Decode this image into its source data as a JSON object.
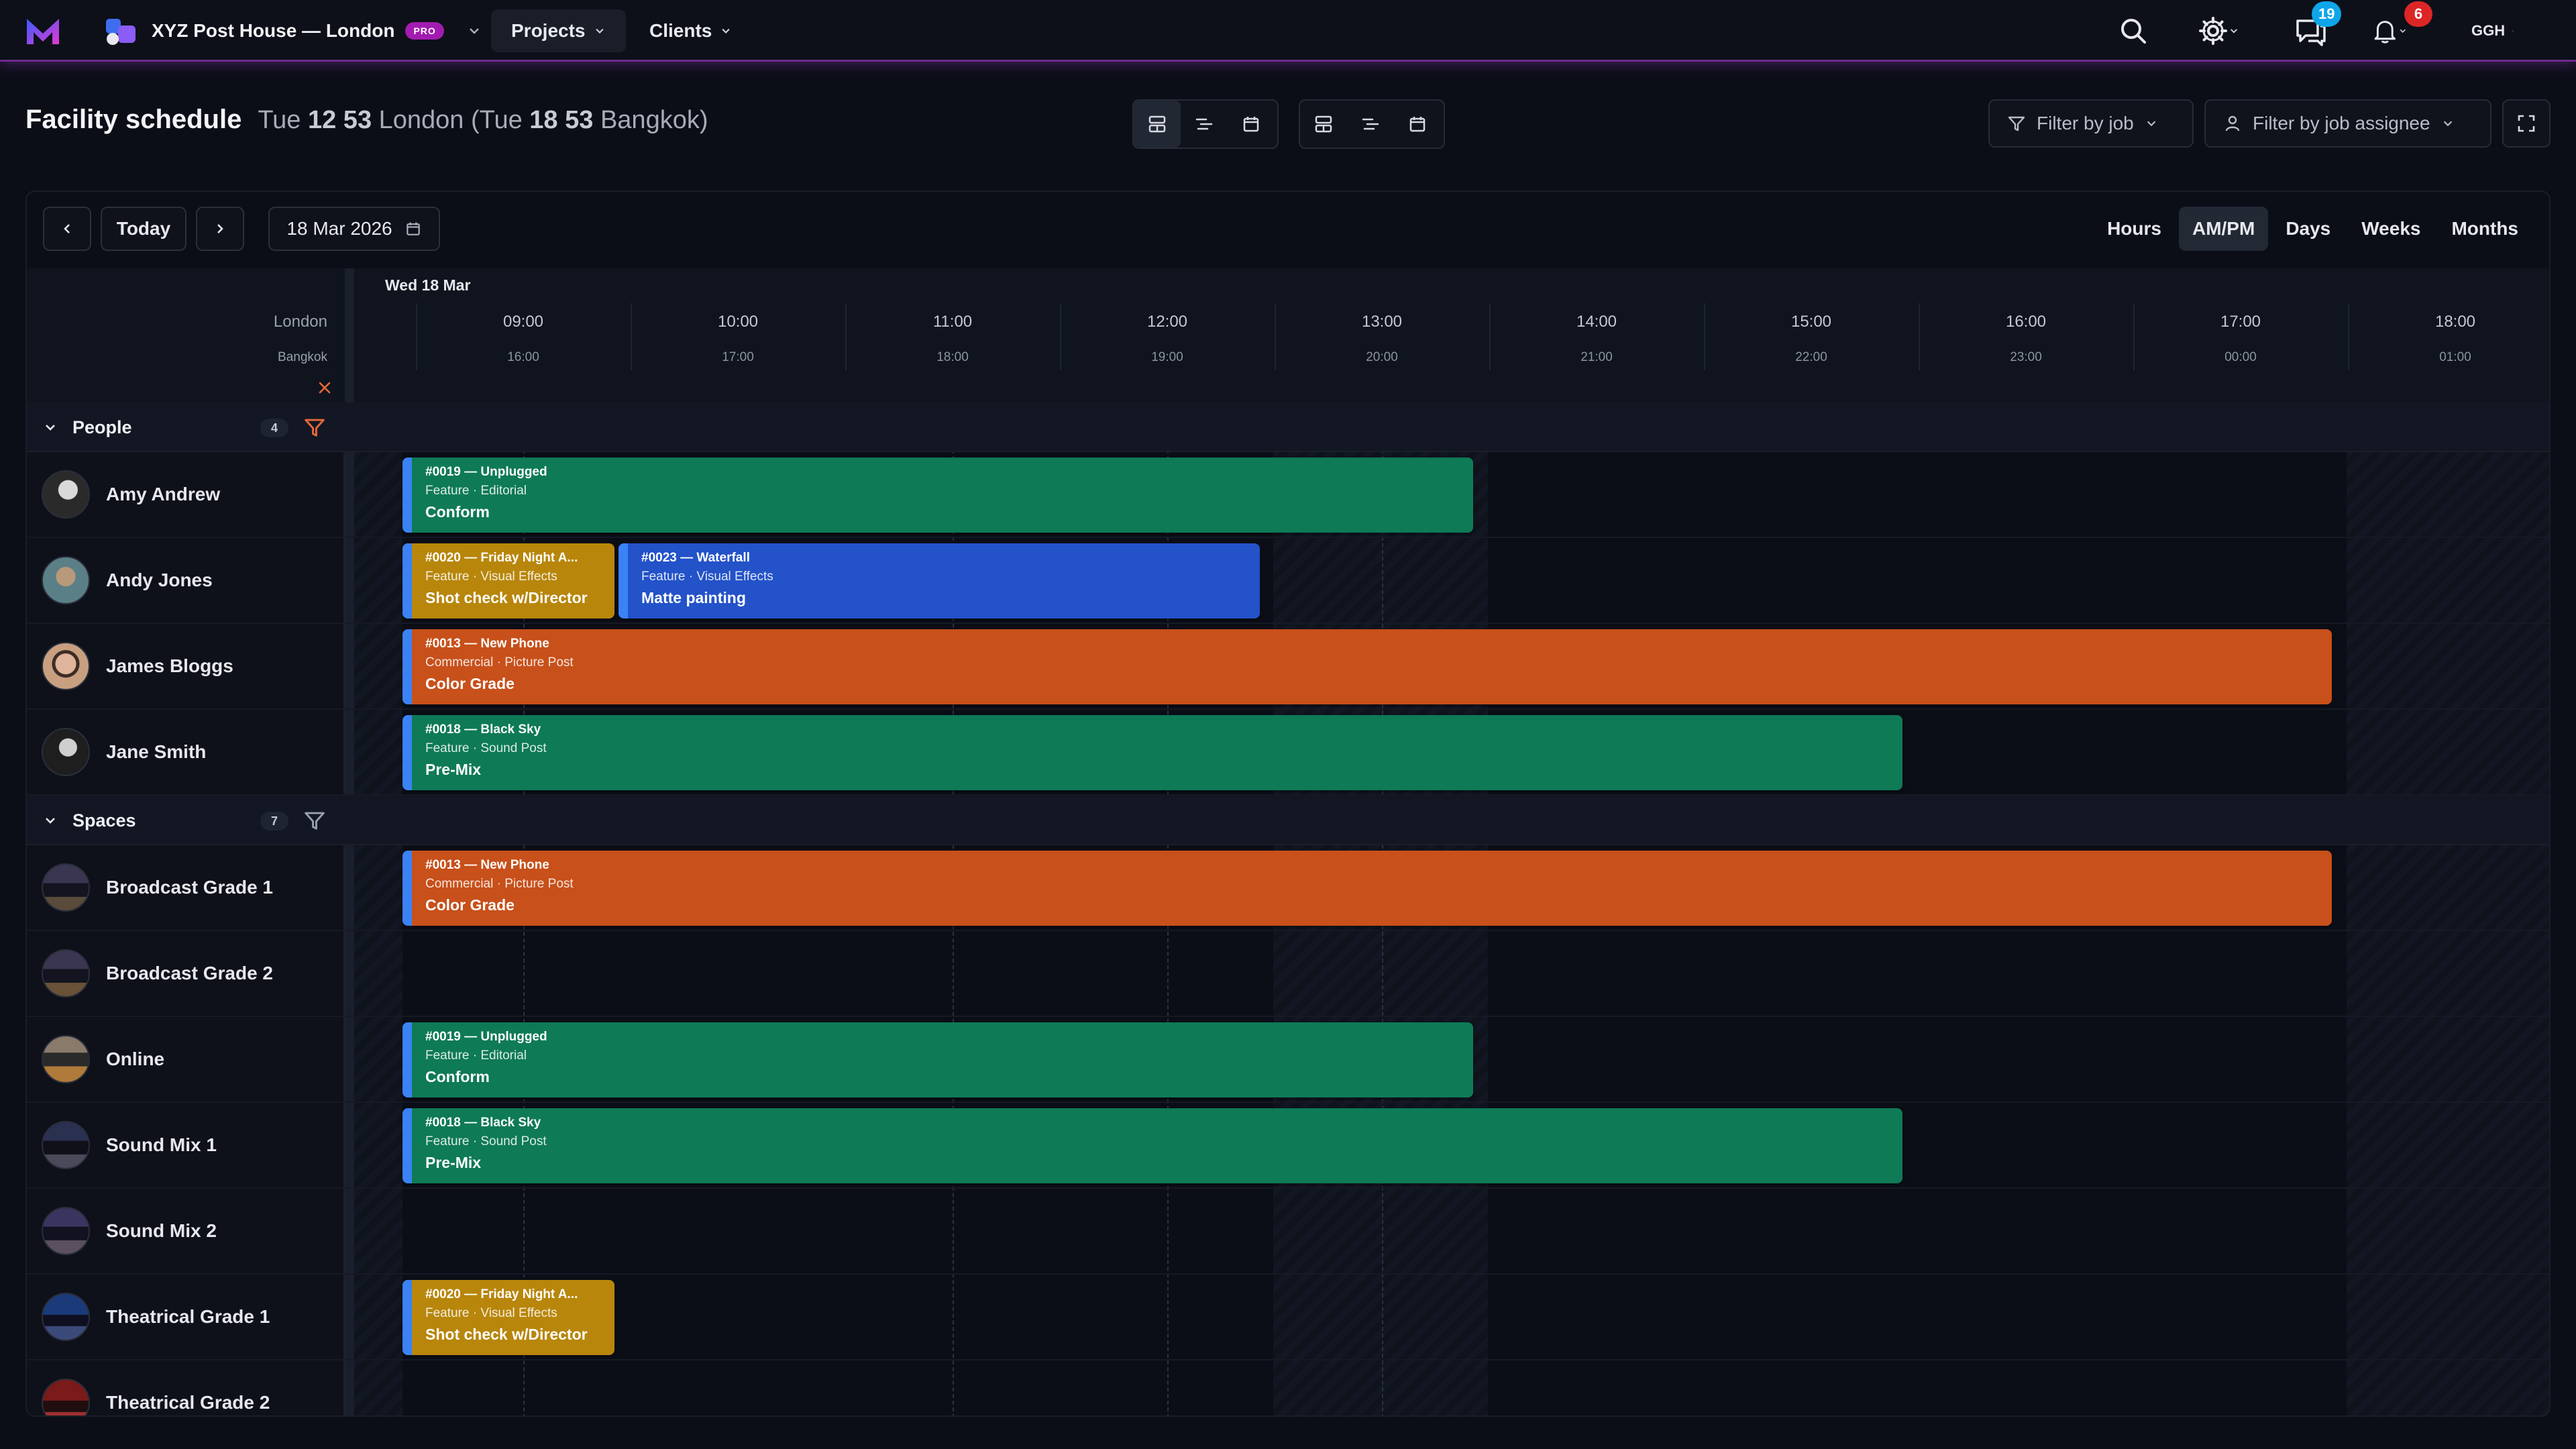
{
  "app": {
    "org_name": "XYZ Post House — London",
    "plan_badge": "PRO",
    "nav": [
      {
        "label": "Projects"
      },
      {
        "label": "Clients"
      }
    ],
    "messages_count": "19",
    "notifications_count": "6",
    "user_initials": "GGH"
  },
  "header": {
    "title": "Facility schedule",
    "time_prefix": "Tue",
    "local_time": "12 53",
    "local_city": "London (Tue",
    "remote_time": "18 53",
    "remote_city": "Bangkok)",
    "filter_job": "Filter by job",
    "filter_assignee": "Filter by job assignee"
  },
  "toolbar": {
    "today": "Today",
    "date": "18 Mar 2026",
    "scales": [
      "Hours",
      "AM/PM",
      "Days",
      "Weeks",
      "Months"
    ],
    "active_scale": "AM/PM"
  },
  "timeline": {
    "date_label": "Wed 18 Mar",
    "tz_primary": "London",
    "tz_secondary": "Bangkok",
    "hours": [
      {
        "london": "09:00",
        "bangkok": "16:00"
      },
      {
        "london": "10:00",
        "bangkok": "17:00"
      },
      {
        "london": "11:00",
        "bangkok": "18:00"
      },
      {
        "london": "12:00",
        "bangkok": "19:00"
      },
      {
        "london": "13:00",
        "bangkok": "20:00"
      },
      {
        "london": "14:00",
        "bangkok": "21:00"
      },
      {
        "london": "15:00",
        "bangkok": "22:00"
      },
      {
        "london": "16:00",
        "bangkok": "23:00"
      },
      {
        "london": "17:00",
        "bangkok": "00:00"
      },
      {
        "london": "18:00",
        "bangkok": "01:00"
      }
    ]
  },
  "sections": {
    "people": {
      "label": "People",
      "count": "4"
    },
    "spaces": {
      "label": "Spaces",
      "count": "7"
    }
  },
  "people": [
    {
      "name": "Amy Andrew"
    },
    {
      "name": "Andy Jones"
    },
    {
      "name": "James Bloggs"
    },
    {
      "name": "Jane Smith"
    }
  ],
  "spaces": [
    {
      "name": "Broadcast Grade 1"
    },
    {
      "name": "Broadcast Grade 2"
    },
    {
      "name": "Online"
    },
    {
      "name": "Sound Mix 1"
    },
    {
      "name": "Sound Mix 2"
    },
    {
      "name": "Theatrical Grade 1"
    },
    {
      "name": "Theatrical Grade 2"
    }
  ],
  "events": [
    {
      "title": "#0019 — Unplugged",
      "sub": "Feature · Editorial",
      "task": "Conform"
    },
    {
      "title": "#0020 — Friday Night A...",
      "sub": "Feature · Visual Effects",
      "task": "Shot check w/Director"
    },
    {
      "title": "#0023 — Waterfall",
      "sub": "Feature · Visual Effects",
      "task": "Matte painting"
    },
    {
      "title": "#0013 — New Phone",
      "sub": "Commercial · Picture Post",
      "task": "Color Grade"
    },
    {
      "title": "#0018 — Black Sky",
      "sub": "Feature · Sound Post",
      "task": "Pre-Mix"
    },
    {
      "title": "#0013 — New Phone",
      "sub": "Commercial · Picture Post",
      "task": "Color Grade"
    },
    {
      "title": "#0019 — Unplugged",
      "sub": "Feature · Editorial",
      "task": "Conform"
    },
    {
      "title": "#0018 — Black Sky",
      "sub": "Feature · Sound Post",
      "task": "Pre-Mix"
    },
    {
      "title": "#0020 — Friday Night A...",
      "sub": "Feature · Visual Effects",
      "task": "Shot check w/Director"
    }
  ],
  "colors": {
    "editorial": "#0e7a56",
    "vfx_gold": "#b8860b",
    "vfx_blue": "#2352c9",
    "picture_post": "#c8501a",
    "accent_purple": "#a21caf"
  }
}
